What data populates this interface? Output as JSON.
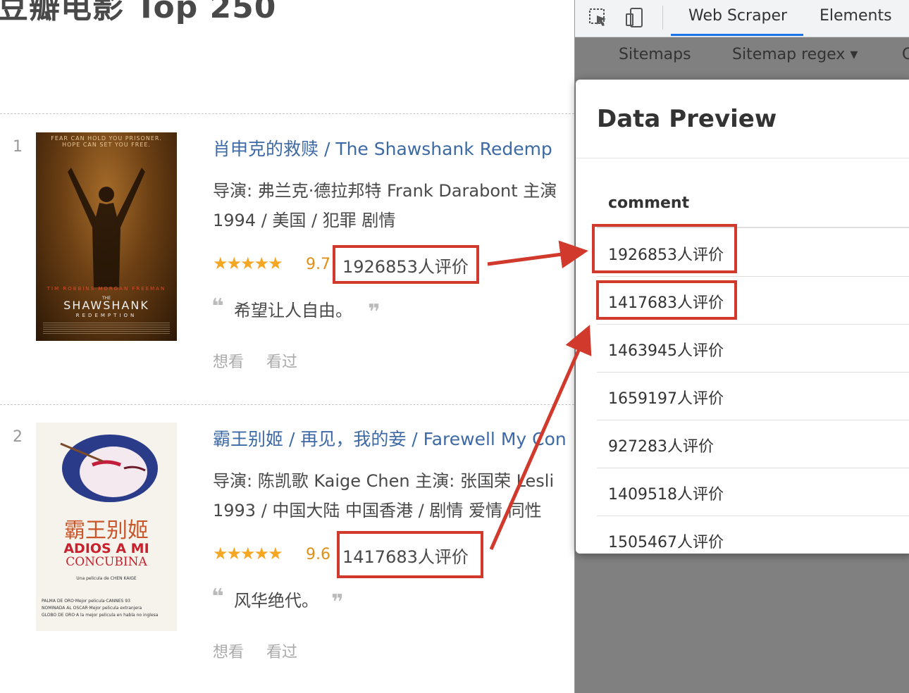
{
  "page": {
    "title": "豆瓣电影 Top 250"
  },
  "movies": [
    {
      "rank": "1",
      "title": "肖申克的救赎  / The Shawshank Redemp",
      "meta_line1": "导演: 弗兰克·德拉邦特 Frank Darabont   主演",
      "meta_line2": "1994 / 美国 / 犯罪 剧情",
      "stars": "★★★★★",
      "score": "9.7",
      "votes": "1926853人评价",
      "quote": "希望让人自由。",
      "poster": {
        "top_text": "FEAR CAN HOLD YOU PRISONER. HOPE CAN SET YOU FREE.",
        "actors": "TIM ROBBINS   MORGAN FREEMAN",
        "title_small": "THE",
        "title": "SHAWSHANK",
        "subtitle": "REDEMPTION"
      }
    },
    {
      "rank": "2",
      "title": "霸王别姬  / 再见，我的妾 / Farewell My Con",
      "meta_line1": "导演: 陈凯歌 Kaige Chen   主演: 张国荣 Lesli",
      "meta_line2": "1993 / 中国大陆 中国香港 / 剧情 爱情 同性",
      "stars": "★★★★★",
      "score": "9.6",
      "votes": "1417683人评价",
      "quote": "风华绝代。",
      "poster": {
        "title_cn": "霸王别姬",
        "title": "ADIOS A MI",
        "subtitle": "CONCUBINA",
        "director_line": "Una pelicula de CHEN KAIGE",
        "awards_1": "PALMA DE ORO·Mejor pelicula·CANNES 93",
        "awards_2": "NOMINADA AL OSCAR·Mejor pelicula extranjera",
        "awards_3": "GLOBO DE ORO·A la mejor pelicula en habla no inglesa"
      }
    }
  ],
  "actions": {
    "want": "想看",
    "seen": "看过"
  },
  "quote_marks": {
    "open": "❝",
    "close": "❞"
  },
  "devtools": {
    "tabs": [
      "Web Scraper",
      "Elements"
    ],
    "active_tab": "Web Scraper",
    "nav": [
      "Sitemaps",
      "Sitemap regex ▾",
      "C"
    ]
  },
  "data_preview": {
    "title": "Data Preview",
    "column": "comment",
    "rows": [
      "1926853人评价",
      "1417683人评价",
      "1463945人评价",
      "1659197人评价",
      "927283人评价",
      "1409518人评价",
      "1505467人评价"
    ]
  },
  "colors": {
    "link": "#3d6aa4",
    "star": "#f5a623",
    "highlight": "#d0392b",
    "tab_accent": "#1a73e8"
  }
}
